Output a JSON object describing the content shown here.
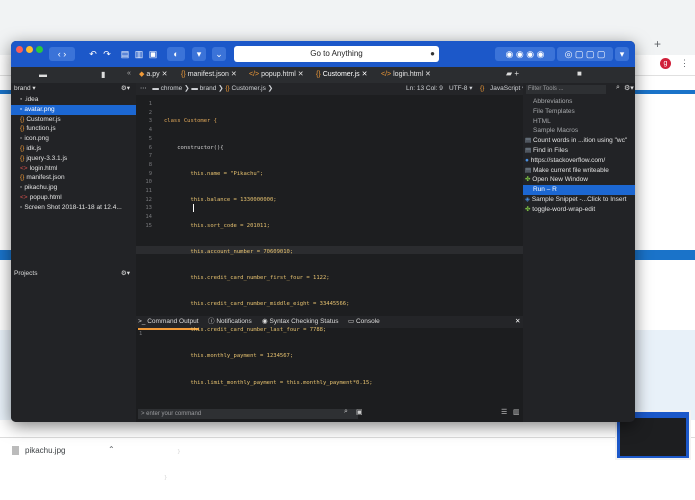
{
  "browser": {
    "new_tab_symbol": "+",
    "profile_initial": "g",
    "download_file": "pikachu.jpg"
  },
  "app": {
    "title": "Go to Anything",
    "tabs": [
      {
        "label": "a.py",
        "icon": "python-icon"
      },
      {
        "label": "manifest.json",
        "icon": "json-icon"
      },
      {
        "label": "popup.html",
        "icon": "html-icon"
      },
      {
        "label": "Customer.js",
        "icon": "js-icon",
        "active": true
      },
      {
        "label": "login.html",
        "icon": "html-icon"
      }
    ],
    "sidebar": {
      "project_label": "brand",
      "files": [
        {
          "name": ".idea",
          "icon": "folder-icon"
        },
        {
          "name": "avatar.png",
          "icon": "image-icon",
          "selected": true
        },
        {
          "name": "Customer.js",
          "icon": "js-icon"
        },
        {
          "name": "function.js",
          "icon": "js-icon"
        },
        {
          "name": "icon.png",
          "icon": "image-icon"
        },
        {
          "name": "idk.js",
          "icon": "js-icon"
        },
        {
          "name": "jquery-3.3.1.js",
          "icon": "js-icon"
        },
        {
          "name": "login.html",
          "icon": "html-icon"
        },
        {
          "name": "manifest.json",
          "icon": "json-icon"
        },
        {
          "name": "pikachu.jpg",
          "icon": "image-icon"
        },
        {
          "name": "popup.html",
          "icon": "html-icon"
        },
        {
          "name": "Screen Shot 2018-11-18 at 12.4...",
          "icon": "image-icon"
        }
      ],
      "projects_label": "Projects"
    },
    "breadcrumb": {
      "items": [
        "chrome",
        "brand",
        "Customer.js"
      ],
      "position": "Ln: 13 Col: 9",
      "encoding": "UTF-8",
      "language": "JavaScript"
    },
    "code": {
      "line_numbers": [
        "1",
        "2",
        "3",
        "4",
        "5",
        "6",
        "7",
        "8",
        "9",
        "10",
        "11",
        "12",
        "13",
        "14",
        "15"
      ],
      "lines": [
        "class Customer {",
        "    constructor(){",
        "        this.name = \"Pikachu\";",
        "        this.balance = 1330000000;",
        "        this.sort_code = 201011;",
        "        this.account_number = 70609010;",
        "        this.credit_card_number_first_four = 1122;",
        "        this.credit_card_number_middle_eight = 33445566;",
        "        this.credit_card_number_last_four = 7788;",
        "        this.monthly_payment = 1234567;",
        "        this.limit_monthly_payment = this.monthly_payment*0.15;",
        "",
        "        ",
        "    }",
        "}"
      ]
    },
    "bottom": {
      "tabs": [
        "Command Output",
        "Notifications",
        "Syntax Checking Status",
        "Console"
      ],
      "output_line": "1",
      "command_placeholder": "> enter your command"
    },
    "tools": {
      "filter_placeholder": "Filter Tools ...",
      "items": [
        {
          "label": "Abbreviations",
          "style": "dim"
        },
        {
          "label": "File Templates",
          "style": "dim"
        },
        {
          "label": "HTML",
          "style": "dim"
        },
        {
          "label": "Sample Macros",
          "style": "dim"
        },
        {
          "label": "Count words in ...ition using \"wc\"",
          "style": "normal"
        },
        {
          "label": "Find in Files",
          "style": "normal"
        },
        {
          "label": "https://stackoverflow.com/",
          "style": "normal"
        },
        {
          "label": "Make current file writeable",
          "style": "normal"
        },
        {
          "label": "Open New Window",
          "style": "normal"
        },
        {
          "label": "Run – R",
          "style": "selected"
        },
        {
          "label": "Sample Snippet -...Click to Insert",
          "style": "normal"
        },
        {
          "label": "toggle-word-wrap-edit",
          "style": "normal"
        }
      ]
    }
  },
  "colors": {
    "accent": "#1c58c9",
    "selection": "#1c67d2",
    "active_tab_underline": "#f29b38"
  }
}
